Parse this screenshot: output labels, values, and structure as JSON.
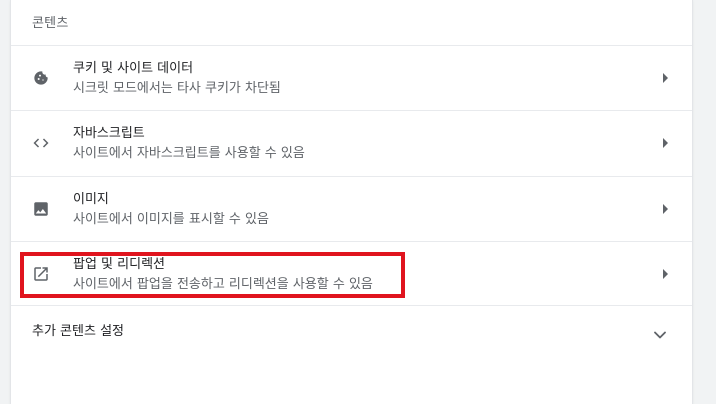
{
  "section": {
    "title": "콘텐츠"
  },
  "rows": [
    {
      "label": "쿠키 및 사이트 데이터",
      "sub": "시크릿 모드에서는 타사 쿠키가 차단됨",
      "icon": "cookie-icon"
    },
    {
      "label": "자바스크립트",
      "sub": "사이트에서 자바스크립트를 사용할 수 있음",
      "icon": "code-icon"
    },
    {
      "label": "이미지",
      "sub": "사이트에서 이미지를 표시할 수 있음",
      "icon": "image-icon"
    },
    {
      "label": "팝업 및 리디렉션",
      "sub": "사이트에서 팝업을 전송하고 리디렉션을 사용할 수 있음",
      "icon": "open-in-new-icon"
    }
  ],
  "more": {
    "label": "추가 콘텐츠 설정",
    "icon": "chevron-down-icon"
  },
  "colors": {
    "highlight": "#e0141e",
    "text_primary": "#202124",
    "text_secondary": "#5f6368"
  }
}
